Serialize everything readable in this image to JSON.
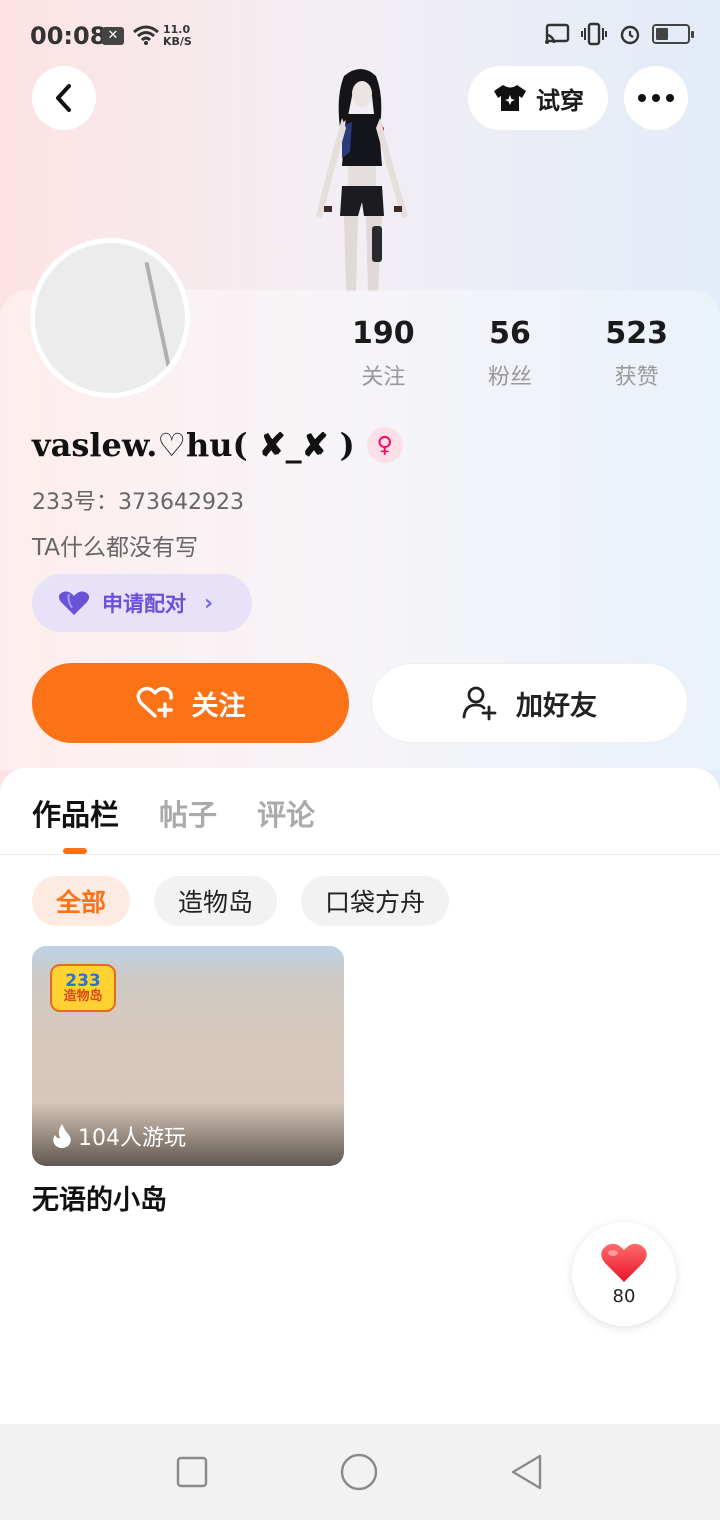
{
  "status": {
    "time": "00:08",
    "net_speed_value": "11.0",
    "net_speed_unit": "KB/S"
  },
  "header": {
    "try_on_label": "试穿"
  },
  "profile": {
    "username": "vaslew.♡hu( ✘_✘ )",
    "uid": "233号：373642923",
    "bio": "TA什么都没有写",
    "pair_label": "申请配对"
  },
  "stats": [
    {
      "value": "190",
      "label": "关注"
    },
    {
      "value": "56",
      "label": "粉丝"
    },
    {
      "value": "523",
      "label": "获赞"
    }
  ],
  "actions": {
    "follow_label": "关注",
    "add_friend_label": "加好友"
  },
  "tabs": [
    {
      "label": "作品栏",
      "active": true
    },
    {
      "label": "帖子",
      "active": false
    },
    {
      "label": "评论",
      "active": false
    }
  ],
  "filters": [
    {
      "label": "全部",
      "active": true
    },
    {
      "label": "造物岛",
      "active": false
    },
    {
      "label": "口袋方舟",
      "active": false
    }
  ],
  "works": [
    {
      "badge_line1": "233",
      "badge_line2": "造物岛",
      "players": "104人游玩",
      "title": "无语的小岛"
    }
  ],
  "like_widget": {
    "count": "80"
  },
  "colors": {
    "accent": "#fb7316",
    "pair": "#6a52d6",
    "gender": "#ff3377"
  },
  "icons": [
    "back-icon",
    "tshirt-icon",
    "more-icon",
    "gender-female-icon",
    "heart-icon",
    "add-user-icon",
    "fire-icon"
  ]
}
